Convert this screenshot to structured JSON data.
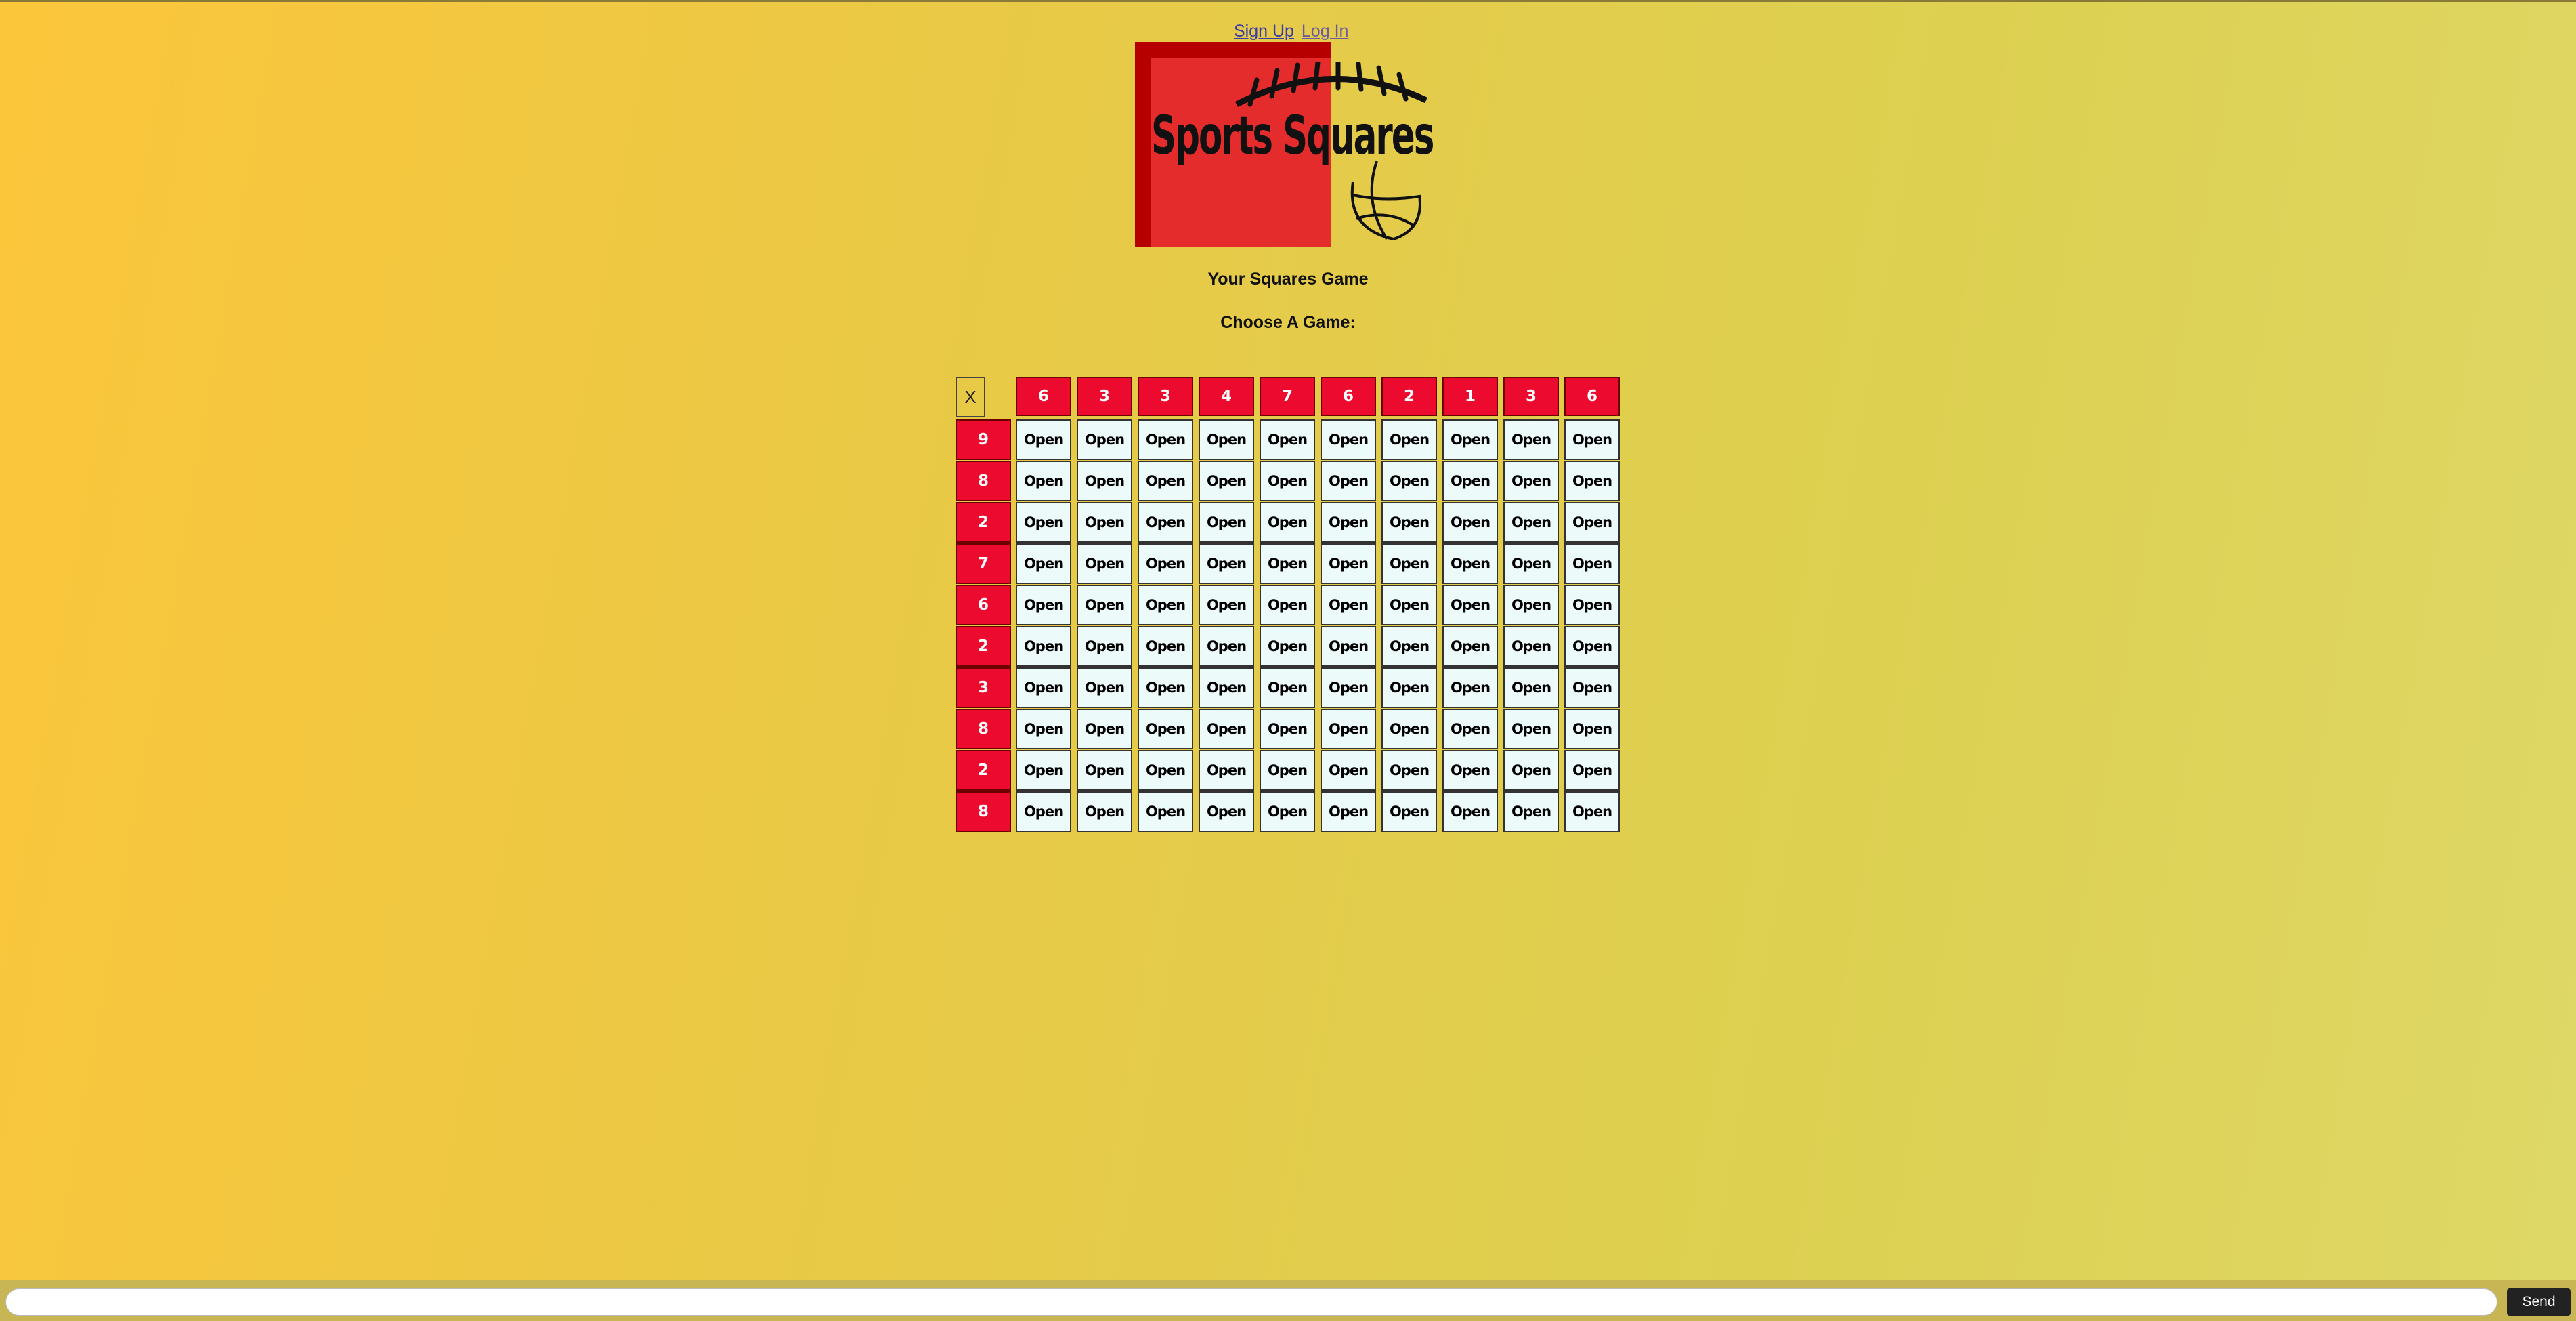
{
  "nav": {
    "signup": "Sign Up",
    "login": "Log In"
  },
  "logo": {
    "text": "Sports Squares"
  },
  "headings": {
    "title": "Your Squares Game",
    "choose": "Choose A Game:"
  },
  "grid": {
    "corner": "X",
    "col_numbers": [
      "6",
      "3",
      "3",
      "4",
      "7",
      "6",
      "2",
      "1",
      "3",
      "6"
    ],
    "row_numbers": [
      "9",
      "8",
      "2",
      "7",
      "6",
      "2",
      "3",
      "8",
      "2",
      "8"
    ],
    "cell_label": "Open"
  },
  "chat": {
    "input_value": "",
    "input_placeholder": "",
    "send_label": "Send"
  },
  "colors": {
    "header_red": "#ec0b2e",
    "cell_bg": "#edfafa",
    "logo_red": "#e42c2c"
  }
}
